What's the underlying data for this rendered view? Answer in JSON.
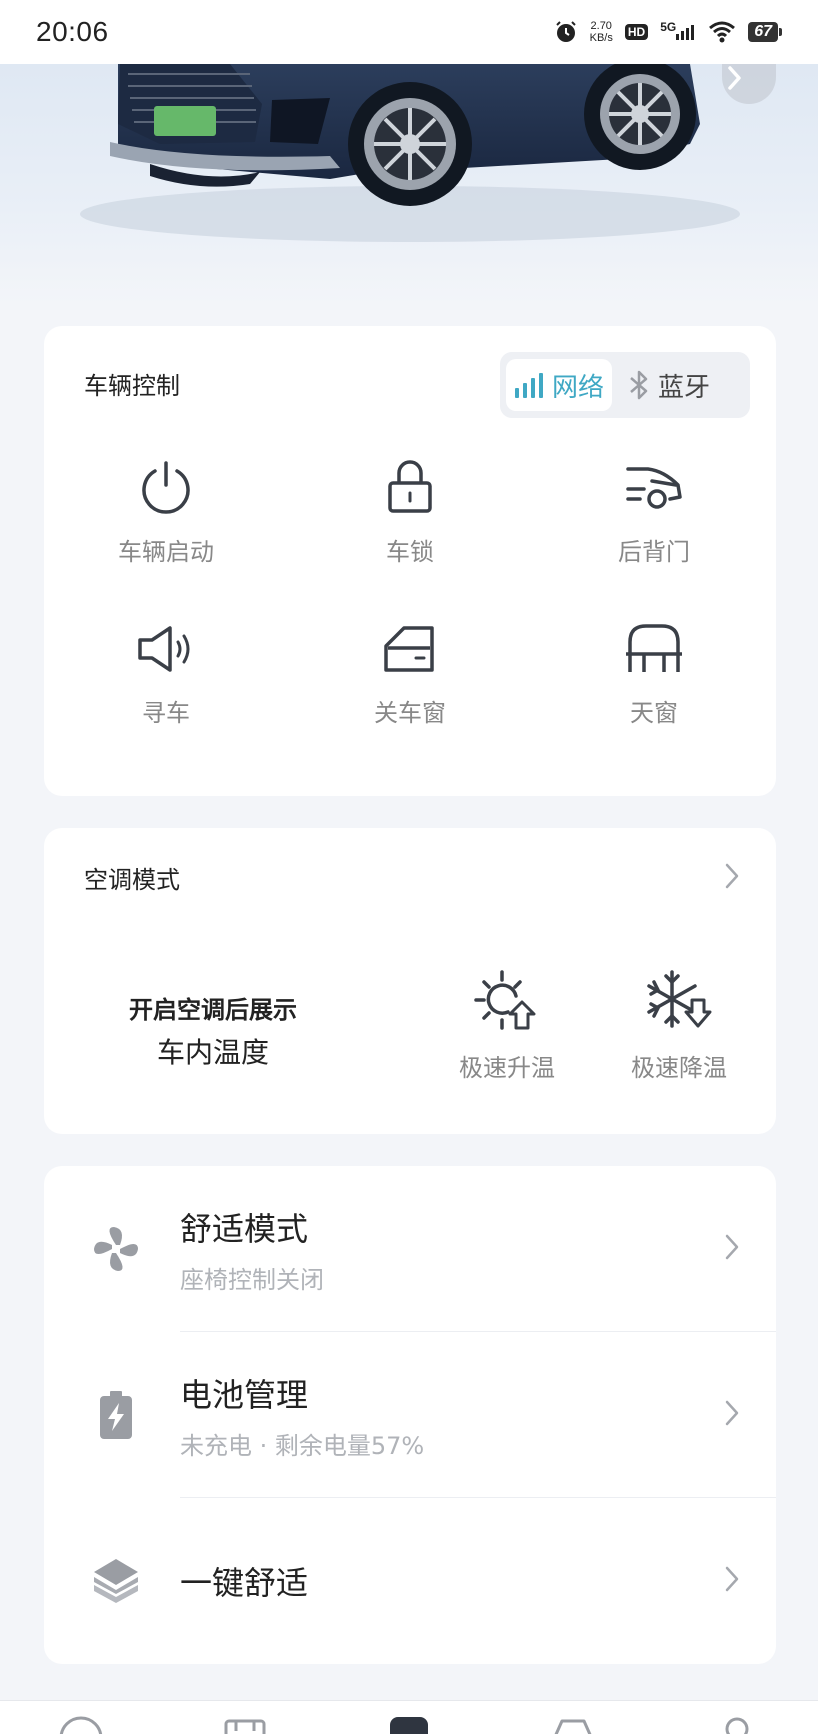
{
  "status_bar": {
    "time": "20:06",
    "speed_value": "2.70",
    "speed_unit": "KB/s",
    "hd": "HD",
    "network": "5G",
    "battery": "67"
  },
  "control": {
    "title": "车辆控制",
    "toggle": {
      "network": "网络",
      "bluetooth": "蓝牙"
    },
    "items": [
      {
        "label": "车辆启动",
        "icon": "power-icon"
      },
      {
        "label": "车锁",
        "icon": "lock-icon"
      },
      {
        "label": "后背门",
        "icon": "tailgate-icon"
      },
      {
        "label": "寻车",
        "icon": "speaker-icon"
      },
      {
        "label": "关车窗",
        "icon": "window-icon"
      },
      {
        "label": "天窗",
        "icon": "sunroof-icon"
      }
    ]
  },
  "ac": {
    "title": "空调模式",
    "temp_hint_line1": "开启空调后展示",
    "temp_hint_line2": "车内温度",
    "heat_label": "极速升温",
    "cool_label": "极速降温"
  },
  "list": {
    "comfort": {
      "title": "舒适模式",
      "sub": "座椅控制关闭"
    },
    "battery": {
      "title": "电池管理",
      "sub": "未充电 · 剩余电量57%"
    },
    "one_key": {
      "title": "一键舒适"
    }
  },
  "colors": {
    "accent": "#3fa8c4",
    "icon_gray": "#9a9da3",
    "text_dark": "#222222"
  }
}
